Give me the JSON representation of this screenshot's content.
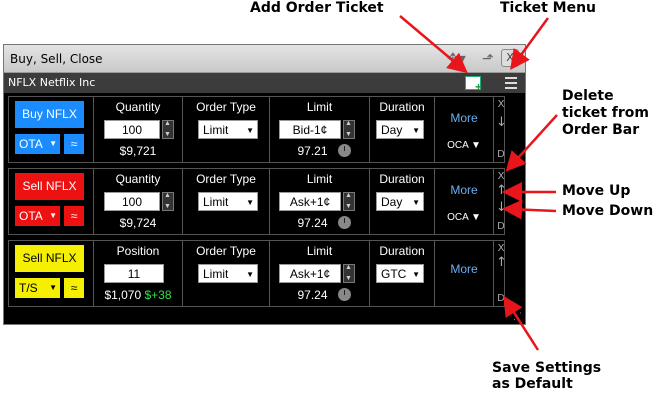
{
  "callouts": {
    "add_order_ticket": "Add Order Ticket",
    "ticket_menu": "Ticket Menu",
    "delete_ticket_line1": "Delete",
    "delete_ticket_line2": "ticket from",
    "delete_ticket_line3": "Order Bar",
    "move_up": "Move Up",
    "move_down": "Move Down",
    "save_settings_line1": "Save Settings",
    "save_settings_line2": "as Default"
  },
  "window": {
    "title": "Buy, Sell, Close",
    "close_label": "X",
    "symbol_label": "NFLX Netflix Inc"
  },
  "tickets": [
    {
      "action_label": "Buy NFLX",
      "action_color": "#1a8cff",
      "route_label": "OTA",
      "qty_header": "Quantity",
      "qty_value": "100",
      "qty_sub": "$9,721",
      "order_type_header": "Order Type",
      "order_type_value": "Limit",
      "limit_header": "Limit",
      "limit_value": "Bid-1¢",
      "limit_sub": "97.21",
      "duration_header": "Duration",
      "duration_value": "Day",
      "more_label": "More",
      "oca_label": "OCA",
      "ctrl_x": "X",
      "ctrl_down": "↓",
      "ctrl_d": "D"
    },
    {
      "action_label": "Sell NFLX",
      "action_color": "#ee1111",
      "route_label": "OTA",
      "qty_header": "Quantity",
      "qty_value": "100",
      "qty_sub": "$9,724",
      "order_type_header": "Order Type",
      "order_type_value": "Limit",
      "limit_header": "Limit",
      "limit_value": "Ask+1¢",
      "limit_sub": "97.24",
      "duration_header": "Duration",
      "duration_value": "Day",
      "more_label": "More",
      "oca_label": "OCA",
      "ctrl_x": "X",
      "ctrl_up": "↑",
      "ctrl_down": "↓",
      "ctrl_d": "D"
    },
    {
      "action_label": "Sell NFLX",
      "action_color": "#f5f000",
      "route_label": "T/S",
      "qty_header": "Position",
      "qty_value": "11",
      "qty_sub": "$1,070",
      "qty_sub_gain": "$+38",
      "order_type_header": "Order Type",
      "order_type_value": "Limit",
      "limit_header": "Limit",
      "limit_value": "Ask+1¢",
      "limit_sub": "97.24",
      "duration_header": "Duration",
      "duration_value": "GTC",
      "more_label": "More",
      "ctrl_x": "X",
      "ctrl_up": "↑",
      "ctrl_d": "D"
    }
  ]
}
